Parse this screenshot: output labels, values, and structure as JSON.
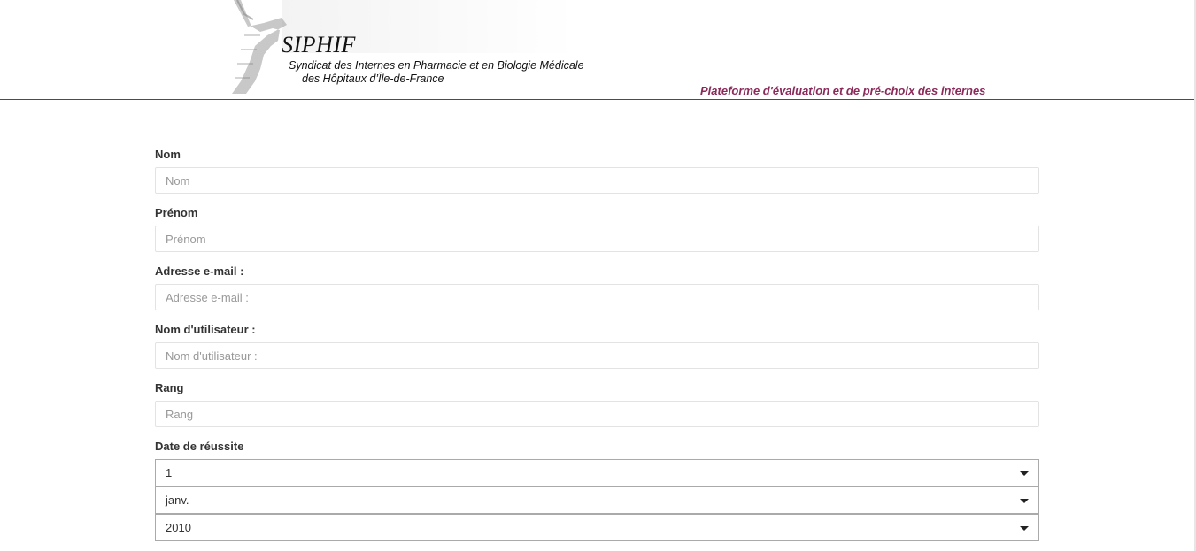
{
  "header": {
    "logo_title": "SIPHIF",
    "logo_line1": "Syndicat des Internes en Pharmacie et en Biologie Médicale",
    "logo_line2": "des Hôpitaux d’Île-de-France",
    "tagline": "Plateforme d'évaluation et de pré-choix des internes"
  },
  "form": {
    "fields": [
      {
        "label": "Nom",
        "placeholder": "Nom"
      },
      {
        "label": "Prénom",
        "placeholder": "Prénom"
      },
      {
        "label": "Adresse e-mail :",
        "placeholder": "Adresse e-mail :"
      },
      {
        "label": "Nom d'utilisateur :",
        "placeholder": "Nom d'utilisateur :"
      },
      {
        "label": "Rang",
        "placeholder": "Rang"
      }
    ],
    "date": {
      "label": "Date de réussite",
      "day": "1",
      "month": "janv.",
      "year": "2010"
    }
  },
  "colors": {
    "accent": "#8a2a5a",
    "border": "#e3e3e3",
    "select_border": "#aaaaaa"
  },
  "icons": {
    "select_caret": "chevron-down-icon"
  }
}
